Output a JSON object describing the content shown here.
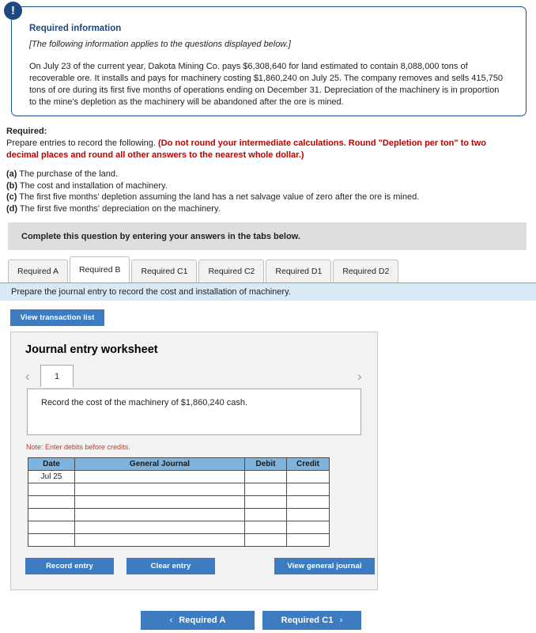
{
  "callout": {
    "icon": "exclamation-icon",
    "icon_glyph": "!",
    "title": "Required information",
    "subtitle": "[The following information applies to the questions displayed below.]",
    "body": "On July 23 of the current year, Dakota Mining Co. pays $6,308,640 for land estimated to contain 8,088,000 tons of recoverable ore. It installs and pays for machinery costing $1,860,240 on July 25. The company removes and sells 415,750 tons of ore during its first five months of operations ending on December 31. Depreciation of the machinery is in proportion to the mine's depletion as the machinery will be abandoned after the ore is mined.",
    "border_color": "#1f4e8c",
    "title_color": "#1b4a82"
  },
  "required": {
    "label": "Required:",
    "lead": "Prepare entries to record the following. ",
    "emphasis": "(Do not round your intermediate calculations. Round \"Depletion per ton\" to two decimal places and round all other answers to the nearest whole dollar.)",
    "emphasis_color": "#c00000",
    "items": [
      {
        "marker": "(a)",
        "text": " The purchase of the land."
      },
      {
        "marker": "(b)",
        "text": " The cost and installation of machinery."
      },
      {
        "marker": "(c)",
        "text": " The first five months' depletion assuming the land has a net salvage value of zero after the ore is mined."
      },
      {
        "marker": "(d)",
        "text": " The first five months' depreciation on the machinery."
      }
    ]
  },
  "complete_bar": {
    "text": "Complete this question by entering your answers in the tabs below.",
    "background": "#dededf"
  },
  "tabs": [
    {
      "label": "Required A",
      "active": false
    },
    {
      "label": "Required B",
      "active": true
    },
    {
      "label": "Required C1",
      "active": false
    },
    {
      "label": "Required C2",
      "active": false
    },
    {
      "label": "Required D1",
      "active": false
    },
    {
      "label": "Required D2",
      "active": false
    }
  ],
  "instruction_bar": {
    "text": "Prepare the journal entry to record the cost and installation of machinery.",
    "background": "#d8eaf6"
  },
  "toolbar": {
    "view_transaction_list": "View transaction list"
  },
  "worksheet": {
    "title": "Journal entry worksheet",
    "prev_icon": "chevron-left-icon",
    "next_icon": "chevron-right-icon",
    "prev_glyph": "‹",
    "next_glyph": "›",
    "page_number": "1",
    "description": "Record the cost of the machinery of $1,860,240 cash.",
    "note": "Note: Enter debits before credits.",
    "note_color": "#c0392b",
    "header_color": "#7eb3dd",
    "columns": [
      "Date",
      "General Journal",
      "Debit",
      "Credit"
    ],
    "rows": [
      {
        "date": "Jul 25",
        "general_journal": "",
        "debit": "",
        "credit": ""
      },
      {
        "date": "",
        "general_journal": "",
        "debit": "",
        "credit": ""
      },
      {
        "date": "",
        "general_journal": "",
        "debit": "",
        "credit": ""
      },
      {
        "date": "",
        "general_journal": "",
        "debit": "",
        "credit": ""
      },
      {
        "date": "",
        "general_journal": "",
        "debit": "",
        "credit": ""
      },
      {
        "date": "",
        "general_journal": "",
        "debit": "",
        "credit": ""
      }
    ],
    "buttons": {
      "record_entry": "Record entry",
      "clear_entry": "Clear entry",
      "view_general_journal": "View general journal"
    }
  },
  "bottom_nav": {
    "prev_label": "Required A",
    "prev_icon": "chevron-left-icon",
    "prev_glyph": "‹",
    "next_label": "Required C1",
    "next_icon": "chevron-right-icon",
    "next_glyph": "›",
    "button_color": "#3d7cc0"
  }
}
